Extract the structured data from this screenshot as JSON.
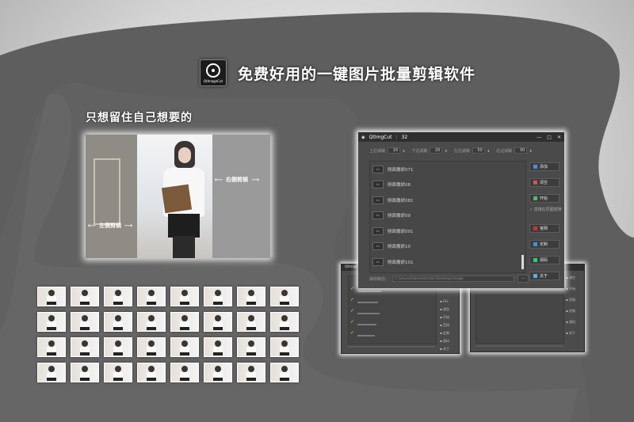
{
  "headline": "免费好用的一键图片批量剪辑软件",
  "logo_label": "QtImageCut",
  "subhead": "只想留住自己想要的",
  "preview": {
    "left_label": "左侧剪辑",
    "right_label": "右侧剪辑"
  },
  "thumbnails": {
    "rows": 4,
    "cols": 8
  },
  "app": {
    "title": "QtImgCut",
    "version": "32",
    "controls": [
      "—",
      "□",
      "✕"
    ],
    "params": [
      {
        "label": "上边减裁",
        "value": "10"
      },
      {
        "label": "下边减裁",
        "value": "20"
      },
      {
        "label": "左边减裁",
        "value": "50"
      },
      {
        "label": "右边减裁",
        "value": "30"
      }
    ],
    "files": [
      "侧面撒娇071",
      "侧面撒娇08",
      "侧面撒娇081",
      "侧面撒娇09",
      "侧面撒娇091",
      "侧面撒娇10",
      "侧面撒娇101"
    ],
    "file_icon_text": "PIC",
    "buttons": [
      {
        "label": "添加",
        "icon": "add-icon",
        "color": "#4a90d9"
      },
      {
        "label": "清空",
        "icon": "clear-icon",
        "color": "#d9534f"
      },
      {
        "label": "开始",
        "icon": "start-icon",
        "color": "#5cb85c"
      }
    ],
    "checkbox_label": "直接在原图替换",
    "buttons_lower": [
      {
        "label": "官网",
        "icon": "home-icon",
        "color": "#c0392b"
      },
      {
        "label": "定制",
        "icon": "custom-icon",
        "color": "#3498db"
      },
      {
        "label": "源码",
        "icon": "code-icon",
        "color": "#2ecc71"
      },
      {
        "label": "关于",
        "icon": "info-icon",
        "color": "#5dade2"
      }
    ],
    "path_label": "保存路径：",
    "path_value": "C:/Users/Administrator/Desktop/image",
    "browse_label": "..."
  },
  "mini_left": {
    "title": "QtImgCut",
    "side_labels": [
      "File",
      "清空",
      "开始",
      "官网",
      "定制",
      "源码",
      "关于"
    ]
  },
  "mini_right": {
    "title": "",
    "side_labels": [
      "清空",
      "开始",
      "官网",
      "定制",
      "源码",
      "关于"
    ]
  }
}
